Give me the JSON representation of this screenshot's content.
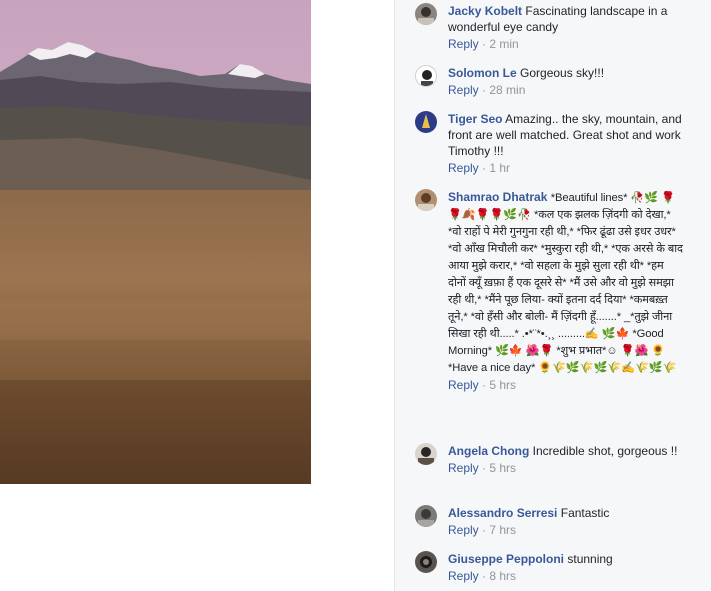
{
  "comments": [
    {
      "author": "Jacky Kobelt",
      "text": "Fascinating landscape in a wonderful eye candy",
      "reply": "Reply",
      "sep": "·",
      "time": "2 min"
    },
    {
      "author": "Solomon Le",
      "text": "Gorgeous sky!!!",
      "reply": "Reply",
      "sep": "·",
      "time": "28 min"
    },
    {
      "author": "Tiger Seo",
      "text": "Amazing.. the sky, mountain, and front are well matched. Great shot and work Timothy !!!",
      "reply": "Reply",
      "sep": "·",
      "time": "1 hr"
    },
    {
      "author": "Shamrao Dhatrak",
      "text": "*Beautiful lines* 🥀🌿 🌹🌹🍂🌹🌹🌿🥀 *कल एक झलक ज़िंदगी को देखा,*          *वो राहों पे मेरी गुनगुना रही थी,* *फिर ढूंढा उसे इधर उधर*          *वो आँख मिचौली कर* *मुस्कुरा रही थी,* *एक अरसे के बाद आया मुझे करार,*          *वो सहला के मुझे सुला रही थी* *हम दोनों क्यूँ ख़फ़ा हैं एक दूसरे से*          *मैं उसे और वो मुझे समझा रही थी,* *मैंने पूछ लिया- क्यों इतना दर्द दिया*          *कमबख़्त तूने,* *वो हँसी और बोली- मैं ज़िंदगी हूँ.......*     _*तुझे जीना सिखा रही थी.....*          .•*¨*•.¸¸ .........✍     🌿🍁 *Good Morning* 🌿🍁 🌺🌹 *शुभ प्रभात*☺ 🌹🌺          🌻 *Have a nice day* 🌻🌾🌿🌾🌿🌾✍🌾🌿🌾",
      "reply": "Reply",
      "sep": "·",
      "time": "5 hrs"
    },
    {
      "author": "Angela Chong",
      "text": "Incredible shot, gorgeous !!",
      "reply": "Reply",
      "sep": "·",
      "time": "5 hrs"
    },
    {
      "author": "Alessandro Serresi",
      "text": "Fantastic",
      "reply": "Reply",
      "sep": "·",
      "time": "7 hrs"
    },
    {
      "author": "Giuseppe Peppoloni",
      "text": "stunning",
      "reply": "Reply",
      "sep": "·",
      "time": "8 hrs"
    }
  ],
  "colors": {
    "link": "#385898",
    "meta": "#90949c",
    "panel": "#f6f7f9"
  }
}
